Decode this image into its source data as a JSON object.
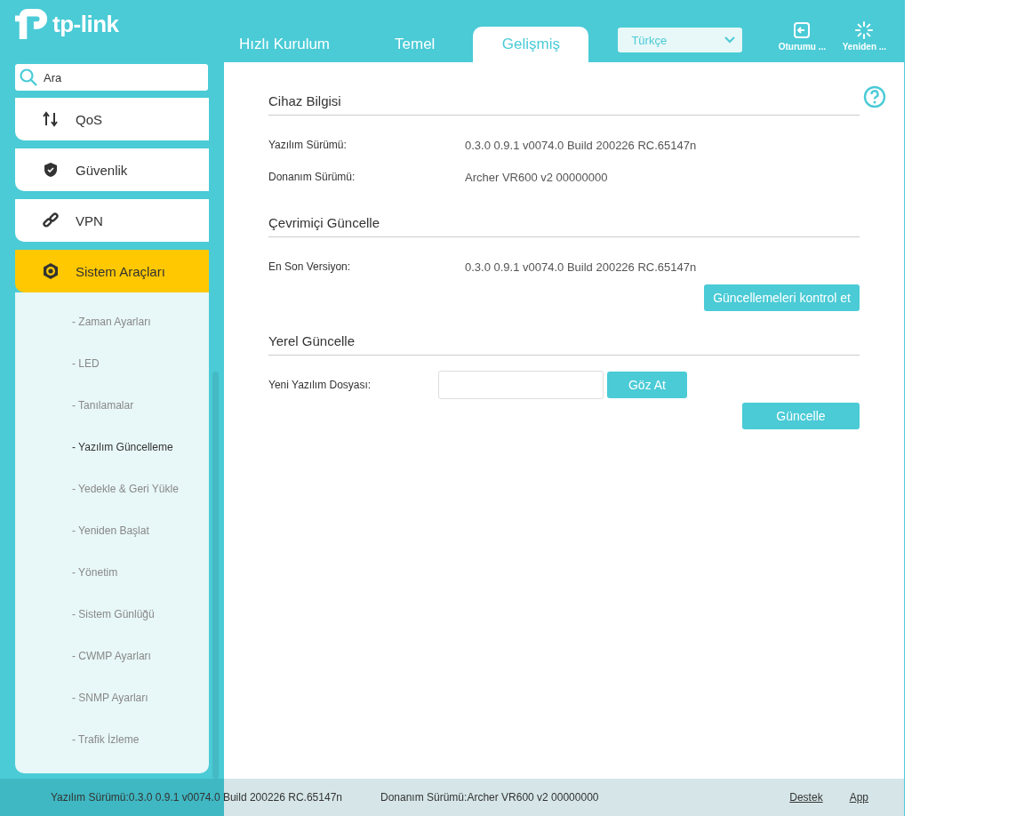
{
  "brand": {
    "name": "tp-link"
  },
  "tabs": [
    {
      "label": "Hızlı Kurulum",
      "selected": false
    },
    {
      "label": "Temel",
      "selected": false
    },
    {
      "label": "Gelişmiş",
      "selected": true
    }
  ],
  "language": {
    "value": "Türkçe"
  },
  "header_actions": [
    {
      "label": "Oturumu ..."
    },
    {
      "label": "Yeniden ..."
    }
  ],
  "search": {
    "placeholder": "Ara"
  },
  "menu": [
    {
      "label": "QoS",
      "selected": false
    },
    {
      "label": "Güvenlik",
      "selected": false
    },
    {
      "label": "VPN",
      "selected": false
    },
    {
      "label": "Sistem Araçları",
      "selected": true,
      "expanded": true,
      "children": [
        {
          "label": "- Zaman Ayarları",
          "selected": false
        },
        {
          "label": "- LED",
          "selected": false
        },
        {
          "label": "- Tanılamalar",
          "selected": false
        },
        {
          "label": "- Yazılım Güncelleme",
          "selected": true
        },
        {
          "label": "- Yedekle & Geri Yükle",
          "selected": false
        },
        {
          "label": "- Yeniden Başlat",
          "selected": false
        },
        {
          "label": "- Yönetim",
          "selected": false
        },
        {
          "label": "- Sistem Günlüğü",
          "selected": false
        },
        {
          "label": "- CWMP Ayarları",
          "selected": false
        },
        {
          "label": "- SNMP Ayarları",
          "selected": false
        },
        {
          "label": "- Trafik İzleme",
          "selected": false
        }
      ]
    }
  ],
  "sections": [
    {
      "title": "Cihaz Bilgisi",
      "items": [
        {
          "kind": "info",
          "label": "Yazılım Sürümü:",
          "value": "0.3.0 0.9.1 v0074.0 Build 200226 RC.65147n"
        },
        {
          "kind": "info",
          "label": "Donanım Sürümü:",
          "value": "Archer VR600 v2 00000000"
        }
      ]
    },
    {
      "title": "Çevrimiçi Güncelle",
      "items": [
        {
          "kind": "info",
          "label": "En Son Versiyon:",
          "value": "0.3.0 0.9.1 v0074.0 Build 200226 RC.65147n"
        },
        {
          "kind": "button",
          "label": "Güncellemeleri kontrol et"
        }
      ]
    },
    {
      "title": "Yerel Güncelle",
      "items": [
        {
          "kind": "file",
          "label": "Yeni Yazılım Dosyası:",
          "button": "Göz At"
        },
        {
          "kind": "button",
          "label": "Güncelle"
        }
      ]
    }
  ],
  "footer": {
    "firmware": "Yazılım Sürümü:0.3.0 0.9.1 v0074.0 Build 200226 RC.65147n",
    "hardware": "Donanım Sürümü:Archer VR600 v2 00000000",
    "links": [
      "Destek",
      "App"
    ]
  }
}
